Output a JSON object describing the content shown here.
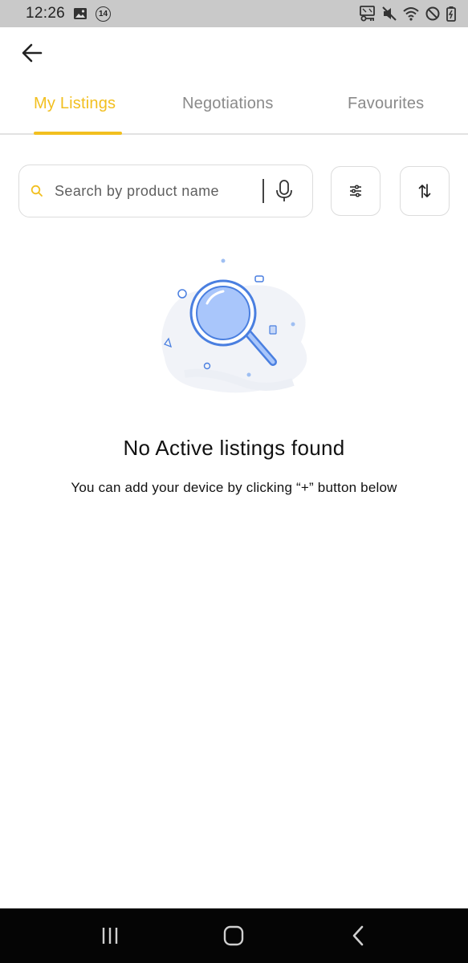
{
  "status_bar": {
    "time": "12:26",
    "notification_count": "14"
  },
  "tabs": [
    {
      "label": "My Listings",
      "active": true
    },
    {
      "label": "Negotiations",
      "active": false
    },
    {
      "label": "Favourites",
      "active": false
    }
  ],
  "search": {
    "placeholder": "Search by product name",
    "value": ""
  },
  "empty_state": {
    "title": "No Active listings found",
    "subtitle": "You can add your device by clicking “+” button below"
  },
  "colors": {
    "accent": "#f2bf1f",
    "illustration_blue": "#4a7fe0",
    "illustration_fill": "#a9c6fb",
    "nav_background": "#050505",
    "status_background": "#c9c9c9"
  },
  "icons": {
    "back": "arrow-left-icon",
    "search": "search-icon",
    "mic": "mic-icon",
    "filter": "sliders-icon",
    "sort": "sort-arrows-icon",
    "nav_recents": "recents-icon",
    "nav_home": "home-icon",
    "nav_back": "back-chevron-icon"
  }
}
